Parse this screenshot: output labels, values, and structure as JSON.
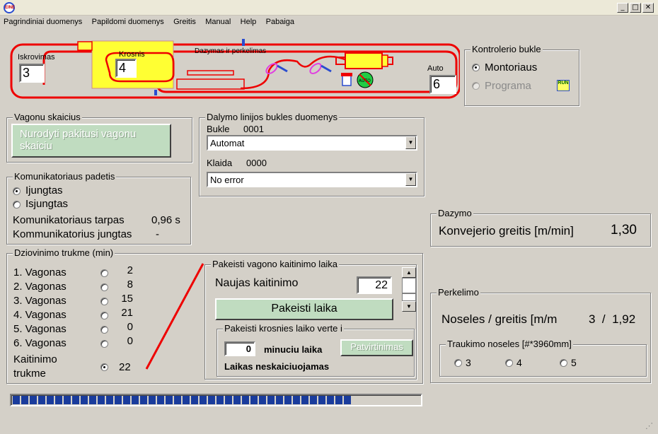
{
  "app": {
    "icon_text": "EINE"
  },
  "menu": [
    "Pagrindiniai duomenys",
    "Papildomi duomenys",
    "Greitis",
    "Manual",
    "Help",
    "Pabaiga"
  ],
  "diagram": {
    "iskrovimas_label": "Iskrovimas",
    "iskrovimas_value": "3",
    "krosnis_label": "Krosnis",
    "krosnis_value": "4",
    "dazymas_label": "Dazymas ir perkelimas",
    "auto_label": "Auto",
    "auto_value": "6",
    "auto_icon_text": "AUTO"
  },
  "kontrolerio": {
    "title": "Kontrolerio bukle",
    "montoriaus": "Montoriaus",
    "programa": "Programa",
    "run_text": "RUN",
    "selected": "Montoriaus"
  },
  "vagonu": {
    "title": "Vagonu skaicius",
    "button_line1": "Nurodyti pakitusi vagonu",
    "button_line2": "skaiciu"
  },
  "dalymo": {
    "title": "Dalymo linijos bukles duomenys",
    "bukle_label": "Bukle",
    "bukle_code": "0001",
    "bukle_value": "Automat",
    "klaida_label": "Klaida",
    "klaida_code": "0000",
    "klaida_value": "No error"
  },
  "komunikatoriaus": {
    "title": "Komunikatoriaus padetis",
    "ijungtas": "Ijungtas",
    "isjungtas": "Isjungtas",
    "selected": "Ijungtas",
    "tarpas_label": "Komunikatoriaus tarpas",
    "tarpas_value": "0,96 s",
    "jungtas_label": "Kommunikatorius jungtas",
    "jungtas_value": "-"
  },
  "dazymo": {
    "title": "Dazymo",
    "label": "Konvejerio greitis [m/min]",
    "value": "1,30"
  },
  "dziovinimo": {
    "title": "Dziovinimo trukme (min)",
    "rows": [
      {
        "label": "1. Vagonas",
        "value": "2"
      },
      {
        "label": "2. Vagonas",
        "value": "8"
      },
      {
        "label": "3. Vagonas",
        "value": "15"
      },
      {
        "label": "4. Vagonas",
        "value": "21"
      },
      {
        "label": "5. Vagonas",
        "value": "0"
      },
      {
        "label": "6. Vagonas",
        "value": "0"
      }
    ],
    "kaitinimo_line1": "Kaitinimo",
    "kaitinimo_line2": "trukme",
    "kaitinimo_value": "22",
    "selected_row": "Kaitinimo"
  },
  "pakeisti": {
    "title": "Pakeisti vagono kaitinimo laika",
    "naujas_label": "Naujas kaitinimo",
    "naujas_value": "22",
    "button": "Pakeisti laika",
    "sub_title": "Pakeisti krosnies laiko verte i",
    "minutes_value": "0",
    "minutes_label": "minuciu laika",
    "confirm_button": "Patvirtinimas",
    "status": "Laikas neskaiciuojamas"
  },
  "perkelimo": {
    "title": "Perkelimo",
    "label": "Noseles / greitis [m/m",
    "value": "3  /  1,92",
    "sub_title": "Traukimo noseles [#*3960mm]",
    "options": [
      "3",
      "4",
      "5"
    ]
  },
  "progress": {
    "fraction": 0.84,
    "segments": 41
  }
}
